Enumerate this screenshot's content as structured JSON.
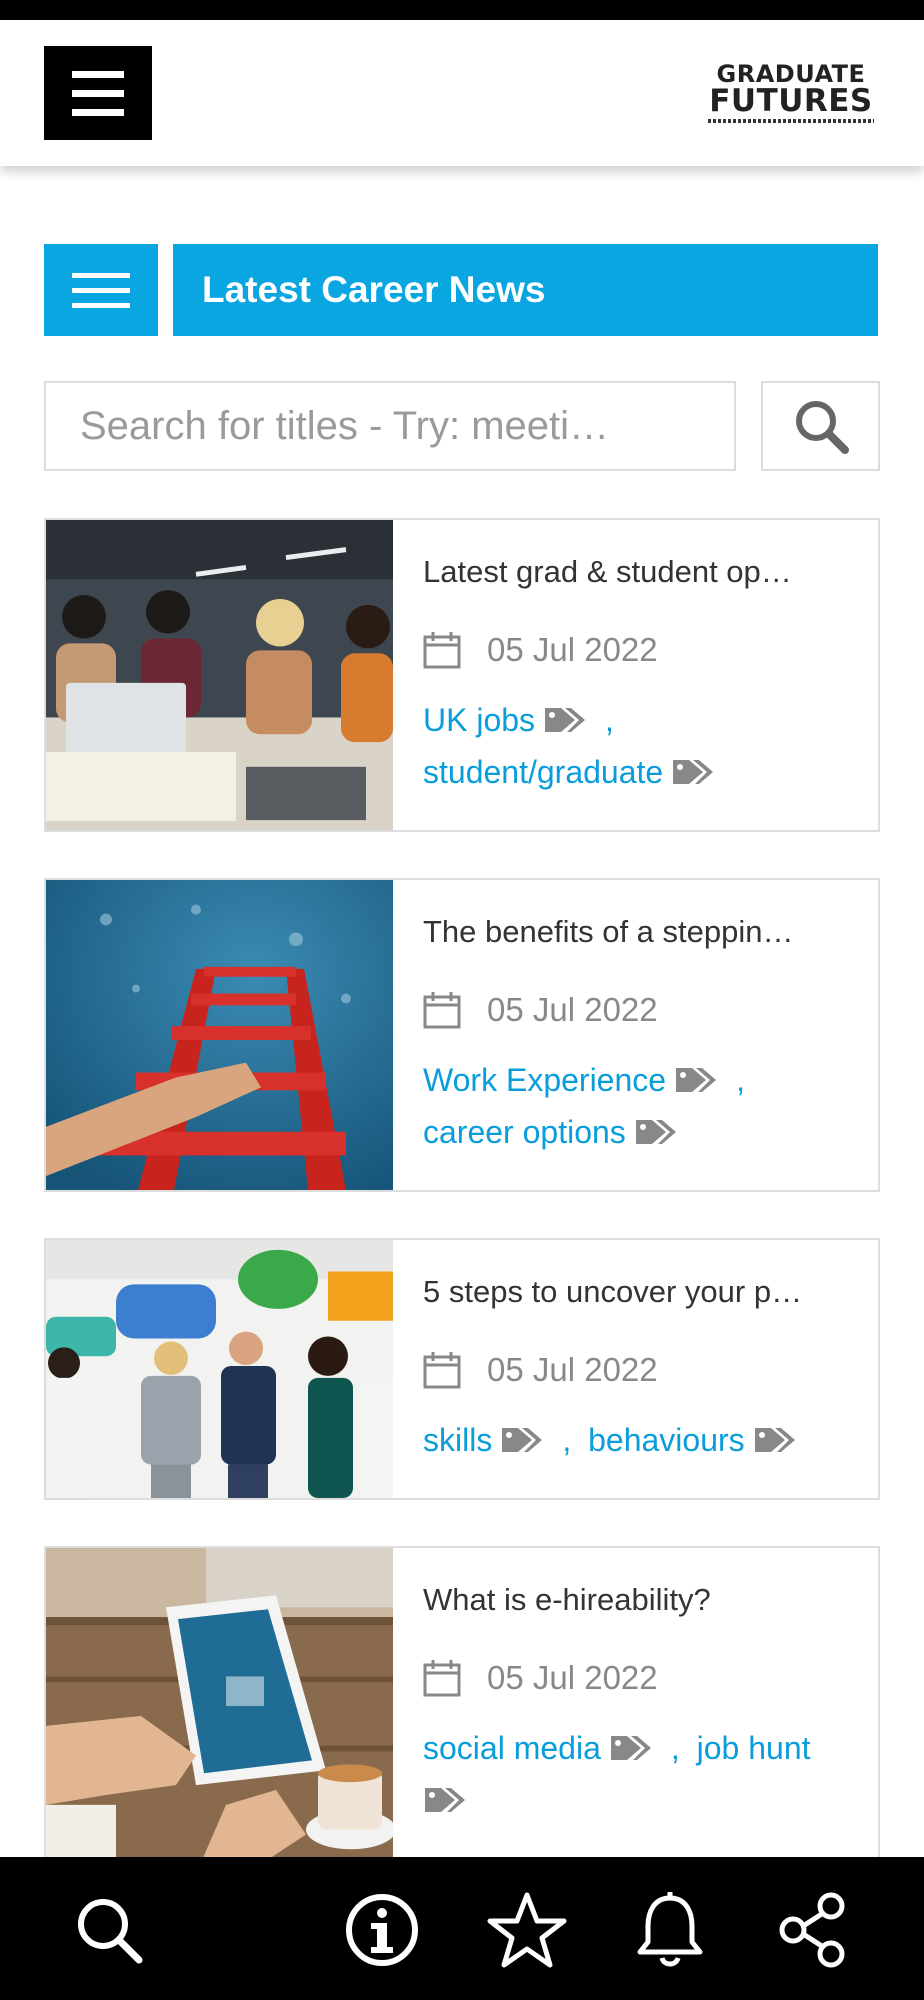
{
  "header": {
    "menu_icon": "hamburger-icon",
    "logo_line1": "GRADUATE",
    "logo_line2": "FUTURES"
  },
  "section": {
    "menu_icon": "hamburger-icon",
    "title": "Latest Career News",
    "accent_color": "#0aa6e2"
  },
  "search": {
    "placeholder": "Search for titles - Try: meeti…",
    "value": "",
    "button_icon": "search-icon"
  },
  "articles": [
    {
      "title": "Latest grad & student op…",
      "date": "05 Jul 2022",
      "image": "students-studying-photo",
      "tags": [
        "UK jobs",
        "student/graduate"
      ]
    },
    {
      "title": "The benefits of a steppin…",
      "date": "05 Jul 2022",
      "image": "red-ladder-photo",
      "tags": [
        "Work Experience",
        "career options"
      ]
    },
    {
      "title": "5 steps to uncover your p…",
      "date": "05 Jul 2022",
      "image": "people-speech-bubbles-photo",
      "tags": [
        "skills",
        "behaviours"
      ]
    },
    {
      "title": "What is e-hireability?",
      "date": "05 Jul 2022",
      "image": "tablet-coffee-photo",
      "tags": [
        "social media",
        "job hunt"
      ]
    }
  ],
  "bottom_nav": {
    "icons": [
      "search-icon",
      "info-icon",
      "star-icon",
      "bell-icon",
      "share-icon"
    ]
  },
  "colors": {
    "link": "#0a9ddb",
    "date_text": "#888888",
    "nav_bg": "#000000"
  }
}
